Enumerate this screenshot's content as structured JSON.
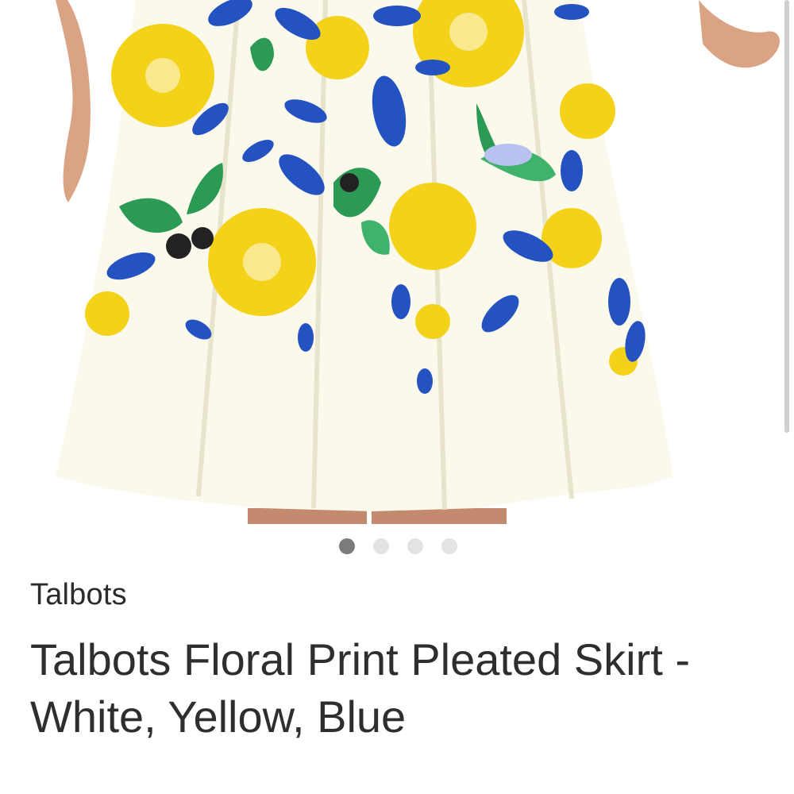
{
  "listing": {
    "image": {
      "alt": "Talbots floral print pleated skirt",
      "colors": [
        "#ffffff",
        "#f5d21b",
        "#2450c2",
        "#2b9a55"
      ]
    },
    "carousel": {
      "count": 4,
      "active_index": 0
    },
    "brand": "Talbots",
    "title": "Talbots Floral Print Pleated Skirt - White, Yellow, Blue"
  }
}
